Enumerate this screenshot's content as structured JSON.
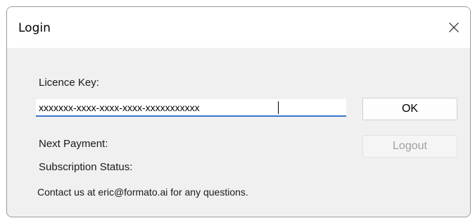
{
  "window": {
    "title": "Login",
    "close_icon": "close-icon"
  },
  "form": {
    "licence_key_label": "Licence Key:",
    "licence_key_value": "xxxxxxx-xxxx-xxxx-xxxx-xxxxxxxxxxx",
    "next_payment_label": "Next Payment:",
    "next_payment_value": "",
    "subscription_status_label": "Subscription Status:",
    "subscription_status_value": "",
    "contact_text": "Contact us at eric@formato.ai for any questions."
  },
  "buttons": {
    "ok_label": "OK",
    "logout_label": "Logout",
    "logout_enabled": false
  },
  "colors": {
    "input_underline": "#3a74c9",
    "disabled_text": "#a0a0a0"
  }
}
